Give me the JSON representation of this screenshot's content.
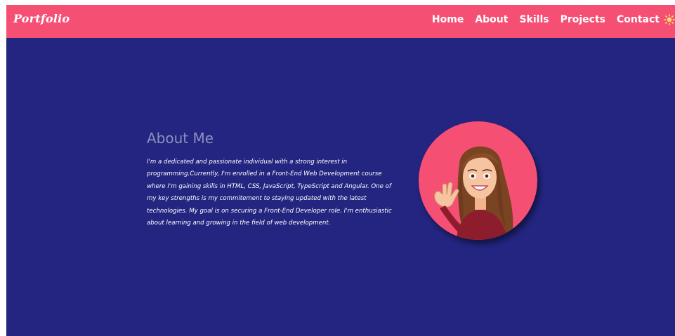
{
  "navbar": {
    "brand": "Portfolio",
    "links": [
      "Home",
      "About",
      "Skills",
      "Projects",
      "Contact"
    ],
    "theme_toggle_icon": "sun-icon"
  },
  "about": {
    "title": "About Me",
    "text": "I'm a dedicated and passionate individual with a strong interest in programming.Currently, I'm enrolled in a Front-End Web Development course where I'm gaining skills in HTML, CSS, JavaScript, TypeScript and Angular. One of my key strengths is my commitement to staying updated with the latest technologies. My goal is on securing a Front-End Developer role. I'm enthusiastic about learning and growing in the field of web development."
  },
  "avatar": {
    "icon": "avatar-illustration"
  },
  "colors": {
    "accent": "#f64f74",
    "background": "#232580",
    "heading": "#8e8fbf",
    "text": "#ffffff"
  }
}
